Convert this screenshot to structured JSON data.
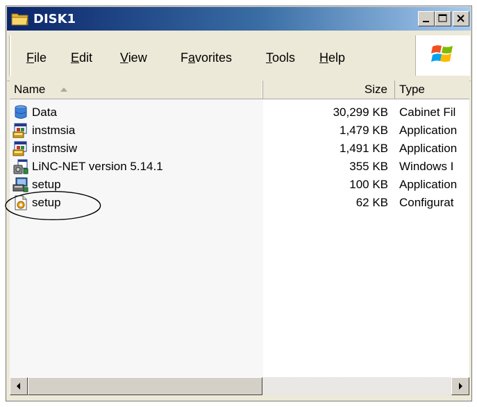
{
  "window": {
    "title": "DISK1",
    "controls": {
      "minimize": "_",
      "maximize": "□",
      "close": "×"
    }
  },
  "menubar": {
    "items": [
      {
        "label_ul": "F",
        "label_rest": "ile"
      },
      {
        "label_ul": "E",
        "label_rest": "dit"
      },
      {
        "label_ul": "V",
        "label_rest": "iew"
      },
      {
        "label_pre": "F",
        "label_ul": "a",
        "label_rest": "vorites"
      },
      {
        "label_ul": "T",
        "label_rest": "ools"
      },
      {
        "label_ul": "H",
        "label_rest": "elp"
      }
    ]
  },
  "columns": {
    "name": "Name",
    "size": "Size",
    "type": "Type"
  },
  "files": [
    {
      "name": "Data",
      "size": "30,299 KB",
      "type": "Cabinet Fil",
      "icon": "cabinet-icon"
    },
    {
      "name": "instmsia",
      "size": "1,479 KB",
      "type": "Application",
      "icon": "application-icon"
    },
    {
      "name": "instmsiw",
      "size": "1,491 KB",
      "type": "Application",
      "icon": "application-icon"
    },
    {
      "name": "LiNC-NET version 5.14.1",
      "size": "355 KB",
      "type": "Windows I",
      "icon": "installer-icon"
    },
    {
      "name": "setup",
      "size": "100 KB",
      "type": "Application",
      "icon": "setup-app-icon"
    },
    {
      "name": "setup",
      "size": "62 KB",
      "type": "Configurat",
      "icon": "config-icon"
    }
  ],
  "colors": {
    "titlebar_start": "#0a246a",
    "titlebar_end": "#a6caf0",
    "window_bg": "#ece9d8",
    "annotation": "#000000"
  }
}
